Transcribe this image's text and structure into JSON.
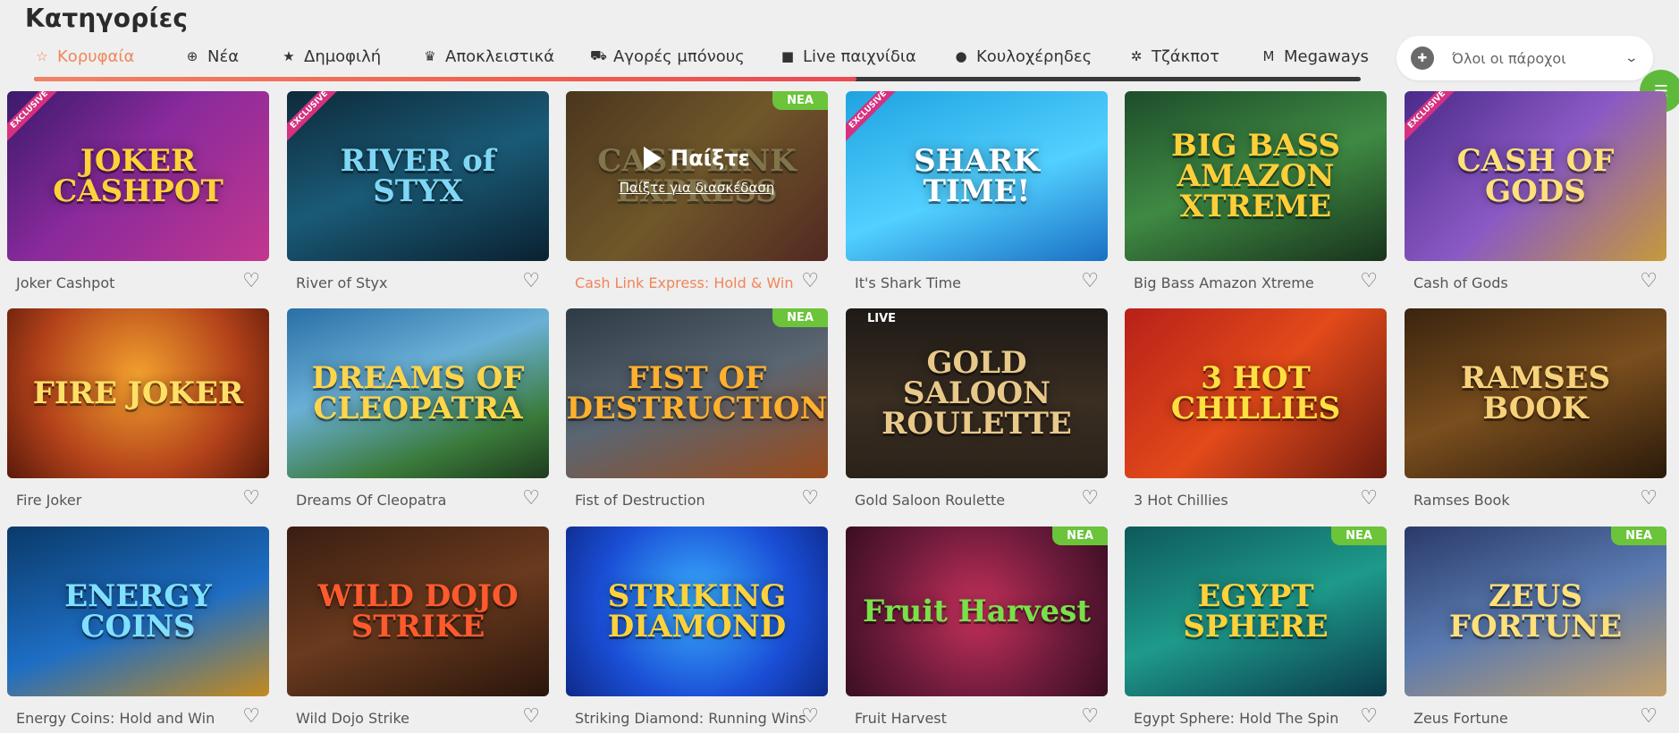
{
  "page": {
    "title": "Κατηγορίες"
  },
  "colors": {
    "accent": "#f0855a",
    "new_badge": "#6bc43a",
    "exclusive_ribbon": "#d4317f",
    "chat": "#5fba3c"
  },
  "tabs": {
    "progress_fraction": 0.62,
    "items": [
      {
        "label": "Κορυφαία",
        "icon": "star-icon",
        "glyph": "☆",
        "active": true
      },
      {
        "label": "Νέα",
        "icon": "plus-circle-icon",
        "glyph": "⊕"
      },
      {
        "label": "Δημοφιλή",
        "icon": "star-icon",
        "glyph": "★"
      },
      {
        "label": "Αποκλειστικά",
        "icon": "crown-icon",
        "glyph": "♛"
      },
      {
        "label": "Αγορές μπόνους",
        "icon": "cart-icon",
        "glyph": "⛟"
      },
      {
        "label": "Live παιχνίδια",
        "icon": "video-camera-icon",
        "glyph": "■"
      },
      {
        "label": "Κουλοχέρηδες",
        "icon": "slot-icon",
        "glyph": "●"
      },
      {
        "label": "Τζάκποτ",
        "icon": "jackpot-icon",
        "glyph": "✲"
      },
      {
        "label": "Megaways",
        "icon": "megaways-icon",
        "glyph": "M"
      }
    ]
  },
  "provider_select": {
    "label": "Όλοι οι πάροχοι",
    "icon": "gamepad-icon"
  },
  "chat": {
    "label": "☰",
    "icon": "chat-bubble-icon"
  },
  "overlay": {
    "play": "Παίξτε",
    "demo": "Παίξτε για διασκέδαση"
  },
  "badges": {
    "exclusive": "EXCLUSIVE",
    "new": "ΝΕΑ",
    "live": "LIVE"
  },
  "games": [
    {
      "name": "Joker Cashpot",
      "art": "JOKER CASHPOT",
      "exclusive": true,
      "bg": "linear-gradient(135deg,#3b1a6b,#8a2a9c 45%,#c1378f)",
      "fg": "#ffd23a"
    },
    {
      "name": "River of Styx",
      "art": "RIVER of STYX",
      "exclusive": true,
      "bg": "linear-gradient(160deg,#0e2a3a,#1a5a76 50%,#0a2130)",
      "fg": "#7fd7f5"
    },
    {
      "name": "Cash Link Express: Hold & Win",
      "art": "CASH LINK EXPRESS",
      "hover": true,
      "new": true,
      "bg": "linear-gradient(135deg,#7a4a12,#d49a2e 50%,#8b2a1a)",
      "fg": "#ffdf7a"
    },
    {
      "name": "It's Shark Time",
      "art": "SHARK TIME!",
      "exclusive": true,
      "bg": "linear-gradient(160deg,#1fa3e0,#52d0ff 55%,#1a6fc4)",
      "fg": "#ffffff"
    },
    {
      "name": "Big Bass Amazon Xtreme",
      "art": "BIG BASS AMAZON XTREME",
      "bg": "linear-gradient(160deg,#1e4d2b,#3f8a43 50%,#18331c)",
      "fg": "#ffcf3a"
    },
    {
      "name": "Cash of Gods",
      "art": "CASH OF GODS",
      "exclusive": true,
      "bg": "linear-gradient(135deg,#4b2a8a,#8a5ac4 50%,#c59a3a)",
      "fg": "#ffe07a"
    },
    {
      "name": "Fire Joker",
      "art": "FIRE JOKER",
      "bg": "radial-gradient(circle at 50% 40%,#f2a12e,#b3421a 60%,#5a1a0a)",
      "fg": "#ffe066"
    },
    {
      "name": "Dreams Of Cleopatra",
      "art": "DREAMS OF CLEOPATRA",
      "bg": "linear-gradient(160deg,#2a6fa6,#6ab0d6 40%,#3a7a3a 75%,#1e3a1e)",
      "fg": "#ffd54a"
    },
    {
      "name": "Fist of Destruction",
      "art": "FIST OF DESTRUCTION",
      "new": true,
      "bg": "linear-gradient(160deg,#2e3a46,#5a6672 50%,#9a4a1a)",
      "fg": "#ffb02e"
    },
    {
      "name": "Gold Saloon Roulette",
      "art": "GOLD SALOON ROULETTE",
      "live": true,
      "bg": "linear-gradient(180deg,#1e1a16,#3a2e22 55%,#2a221a)",
      "fg": "#e8c98a"
    },
    {
      "name": "3 Hot Chillies",
      "art": "3 HOT CHILLIES",
      "bg": "linear-gradient(135deg,#b8201a,#e24a1a 50%,#6a1a0e)",
      "fg": "#ffe040"
    },
    {
      "name": "Ramses Book",
      "art": "RAMSES BOOK",
      "bg": "linear-gradient(160deg,#3a240e,#7a4e1e 50%,#2a1a0a)",
      "fg": "#f7d27a"
    },
    {
      "name": "Energy Coins: Hold and Win",
      "art": "ENERGY COINS",
      "bg": "linear-gradient(160deg,#0a3a6a,#1e6ec4 55%,#c48a1e)",
      "fg": "#7fe0ff"
    },
    {
      "name": "Wild Dojo Strike",
      "art": "WILD DOJO STRIKE",
      "bg": "linear-gradient(160deg,#3a1e12,#6a3a1e 50%,#2a160c)",
      "fg": "#ff5a2e"
    },
    {
      "name": "Striking Diamond: Running Wins",
      "art": "STRIKING DIAMOND",
      "bg": "radial-gradient(circle at 50% 45%,#3ab0ff,#1a4ed6 60%,#0e2a8a)",
      "fg": "#ffd23a"
    },
    {
      "name": "Fruit Harvest",
      "art": "Fruit Harvest",
      "new": true,
      "bg": "radial-gradient(circle at 50% 50%,#c4305a,#6a1a3a 60%,#3a0e22)",
      "fg": "#7ae04a"
    },
    {
      "name": "Egypt Sphere: Hold The Spin",
      "art": "EGYPT SPHERE",
      "new": true,
      "bg": "linear-gradient(160deg,#0e5a5a,#1e9a8a 50%,#0a3a4a)",
      "fg": "#ffd23a"
    },
    {
      "name": "Zeus Fortune",
      "art": "ZEUS FORTUNE",
      "new": true,
      "bg": "linear-gradient(160deg,#2a3a6a,#5a7ab0 50%,#c4a06a)",
      "fg": "#ffe07a"
    }
  ]
}
